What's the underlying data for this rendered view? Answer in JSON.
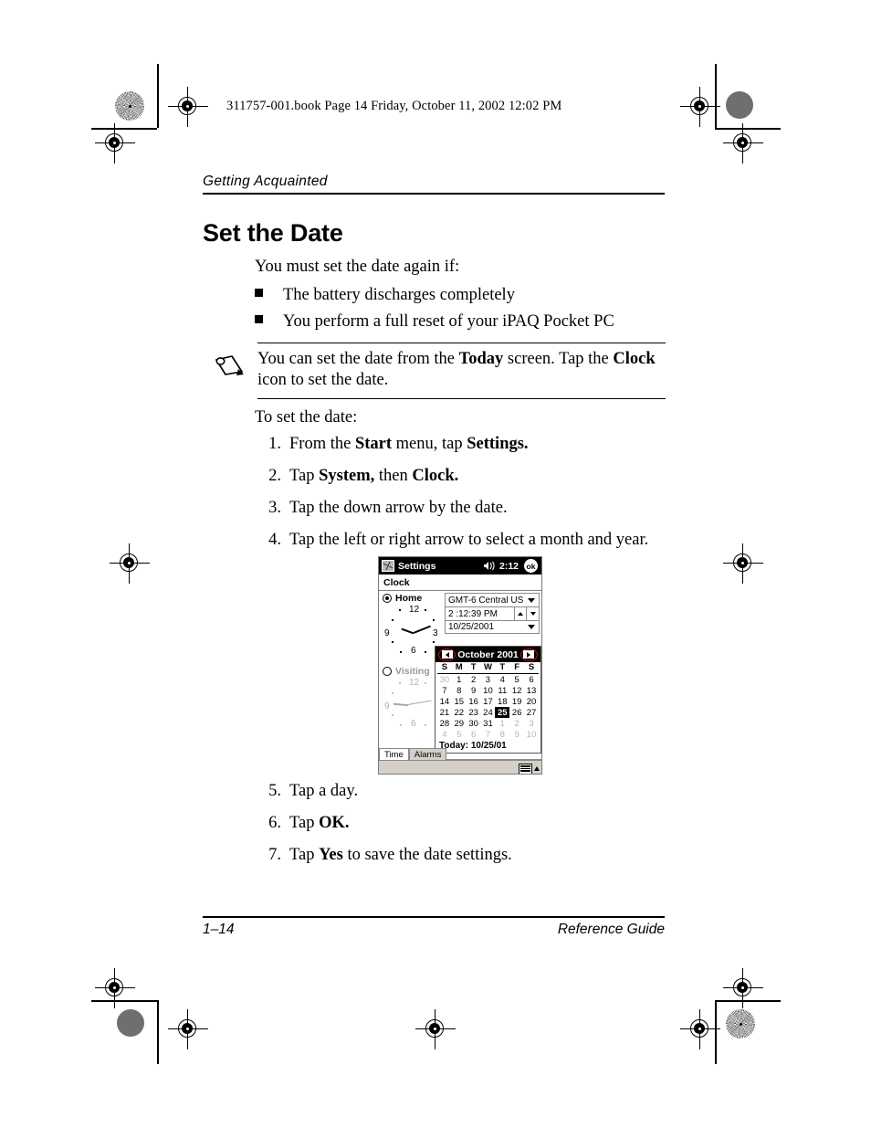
{
  "header": {
    "book_line": "311757-001.book  Page 14  Friday, October 11, 2002  12:02 PM"
  },
  "running_head": "Getting Acquainted",
  "page_title": "Set the Date",
  "intro": "You must set the date again if:",
  "bullets": [
    "The battery discharges completely",
    "You perform a full reset of your iPAQ Pocket PC"
  ],
  "note": {
    "text_part1": "You can set the date from the ",
    "bold1": "Today",
    "text_part2": " screen. Tap the ",
    "bold2": "Clock",
    "text_part3": " icon to set the date."
  },
  "to_set_date": "To set the date:",
  "steps": [
    {
      "num": "1.",
      "p1": "From the ",
      "b1": "Start",
      "p2": " menu, tap ",
      "b2": "Settings.",
      "p3": ""
    },
    {
      "num": "2.",
      "p1": "Tap ",
      "b1": "System,",
      "p2": " then ",
      "b2": "Clock.",
      "p3": ""
    },
    {
      "num": "3.",
      "p1": "Tap the down arrow by the date.",
      "b1": "",
      "p2": "",
      "b2": "",
      "p3": ""
    },
    {
      "num": "4.",
      "p1": "Tap the left or right arrow to select a month and year.",
      "b1": "",
      "p2": "",
      "b2": "",
      "p3": ""
    }
  ],
  "steps_late": [
    {
      "num": "5.",
      "p1": "Tap a day.",
      "b1": "",
      "p2": "",
      "b2": "",
      "p3": ""
    },
    {
      "num": "6.",
      "p1": "Tap ",
      "b1": "OK.",
      "p2": "",
      "b2": "",
      "p3": ""
    },
    {
      "num": "7.",
      "p1": "Tap ",
      "b1": "Yes",
      "p2": " to save the date settings.",
      "b2": "",
      "p3": ""
    }
  ],
  "footer": {
    "page_number": "1–14",
    "guide_name": "Reference Guide"
  },
  "pda": {
    "titlebar": {
      "app": "Settings",
      "time": "2:12",
      "ok_label": "ok",
      "start_icon": "windows-flag-icon",
      "volume_icon": "speaker-icon"
    },
    "subbar": "Clock",
    "home": {
      "label": "Home",
      "selected": true,
      "clock_numerals": [
        "12",
        "3",
        "6",
        "9"
      ]
    },
    "visiting": {
      "label": "Visiting",
      "selected": false,
      "clock_numerals": [
        "12",
        "6",
        "9"
      ]
    },
    "fields": {
      "timezone": "GMT-6 Central US",
      "time": "2 :12:39 PM",
      "date": "10/25/2001"
    },
    "calendar": {
      "month_year": "October 2001",
      "prev_label": "previous-month",
      "next_label": "next-month",
      "weekdays": [
        "S",
        "M",
        "T",
        "W",
        "T",
        "F",
        "S"
      ],
      "weeks": [
        [
          {
            "d": "30",
            "out": true
          },
          {
            "d": "1",
            "out": false
          },
          {
            "d": "2",
            "out": false
          },
          {
            "d": "3",
            "out": false
          },
          {
            "d": "4",
            "out": false
          },
          {
            "d": "5",
            "out": false
          },
          {
            "d": "6",
            "out": false
          }
        ],
        [
          {
            "d": "7",
            "out": false
          },
          {
            "d": "8",
            "out": false
          },
          {
            "d": "9",
            "out": false
          },
          {
            "d": "10",
            "out": false
          },
          {
            "d": "11",
            "out": false
          },
          {
            "d": "12",
            "out": false
          },
          {
            "d": "13",
            "out": false
          }
        ],
        [
          {
            "d": "14",
            "out": false
          },
          {
            "d": "15",
            "out": false
          },
          {
            "d": "16",
            "out": false
          },
          {
            "d": "17",
            "out": false
          },
          {
            "d": "18",
            "out": false
          },
          {
            "d": "19",
            "out": false
          },
          {
            "d": "20",
            "out": false
          }
        ],
        [
          {
            "d": "21",
            "out": false
          },
          {
            "d": "22",
            "out": false
          },
          {
            "d": "23",
            "out": false
          },
          {
            "d": "24",
            "out": false
          },
          {
            "d": "25",
            "out": false,
            "sel": true
          },
          {
            "d": "26",
            "out": false
          },
          {
            "d": "27",
            "out": false
          }
        ],
        [
          {
            "d": "28",
            "out": false
          },
          {
            "d": "29",
            "out": false
          },
          {
            "d": "30",
            "out": false
          },
          {
            "d": "31",
            "out": false
          },
          {
            "d": "1",
            "out": true
          },
          {
            "d": "2",
            "out": true
          },
          {
            "d": "3",
            "out": true
          }
        ],
        [
          {
            "d": "4",
            "out": true
          },
          {
            "d": "5",
            "out": true
          },
          {
            "d": "6",
            "out": true
          },
          {
            "d": "7",
            "out": true
          },
          {
            "d": "8",
            "out": true
          },
          {
            "d": "9",
            "out": true
          },
          {
            "d": "10",
            "out": true
          }
        ]
      ],
      "today": "Today: 10/25/01"
    },
    "tabs": [
      {
        "label": "Time",
        "active": true
      },
      {
        "label": "Alarms",
        "active": false
      }
    ],
    "taskbar": {
      "keyboard_icon": "keyboard-icon"
    }
  },
  "colors": {
    "selection_red": "#d01010",
    "titlebar_black": "#000000",
    "pda_chrome": "#d4d0c8"
  }
}
